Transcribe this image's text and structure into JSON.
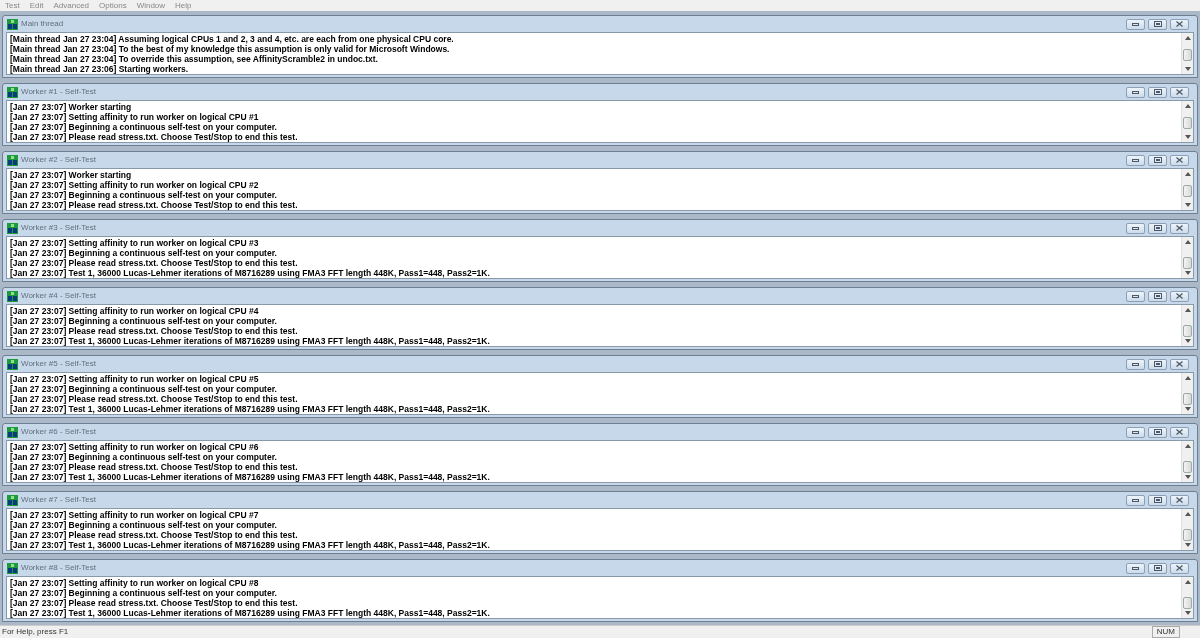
{
  "menu": [
    "Test",
    "Edit",
    "Advanced",
    "Options",
    "Window",
    "Help"
  ],
  "windows": [
    {
      "title": "Main thread",
      "lines": [
        "[Main thread Jan 27 23:04] Assuming logical CPUs 1 and 2, 3 and 4, etc. are each from one physical CPU core.",
        "[Main thread Jan 27 23:04] To the best of my knowledge this assumption is only valid for Microsoft Windows.",
        "[Main thread Jan 27 23:04] To override this assumption, see AffinityScramble2 in undoc.txt.",
        "[Main thread Jan 27 23:06] Starting workers."
      ]
    },
    {
      "title": "Worker #1 - Self-Test",
      "lines": [
        "[Jan 27 23:07] Worker starting",
        "[Jan 27 23:07] Setting affinity to run worker on logical CPU #1",
        "[Jan 27 23:07] Beginning a continuous self-test on your computer.",
        "[Jan 27 23:07] Please read stress.txt.  Choose Test/Stop to end this test."
      ]
    },
    {
      "title": "Worker #2 - Self-Test",
      "lines": [
        "[Jan 27 23:07] Worker starting",
        "[Jan 27 23:07] Setting affinity to run worker on logical CPU #2",
        "[Jan 27 23:07] Beginning a continuous self-test on your computer.",
        "[Jan 27 23:07] Please read stress.txt.  Choose Test/Stop to end this test."
      ]
    },
    {
      "title": "Worker #3 - Self-Test",
      "lines": [
        "[Jan 27 23:07] Setting affinity to run worker on logical CPU #3",
        "[Jan 27 23:07] Beginning a continuous self-test on your computer.",
        "[Jan 27 23:07] Please read stress.txt.  Choose Test/Stop to end this test.",
        "[Jan 27 23:07] Test 1, 36000 Lucas-Lehmer iterations of M8716289 using FMA3 FFT length 448K, Pass1=448, Pass2=1K."
      ]
    },
    {
      "title": "Worker #4 - Self-Test",
      "lines": [
        "[Jan 27 23:07] Setting affinity to run worker on logical CPU #4",
        "[Jan 27 23:07] Beginning a continuous self-test on your computer.",
        "[Jan 27 23:07] Please read stress.txt.  Choose Test/Stop to end this test.",
        "[Jan 27 23:07] Test 1, 36000 Lucas-Lehmer iterations of M8716289 using FMA3 FFT length 448K, Pass1=448, Pass2=1K."
      ]
    },
    {
      "title": "Worker #5 - Self-Test",
      "lines": [
        "[Jan 27 23:07] Setting affinity to run worker on logical CPU #5",
        "[Jan 27 23:07] Beginning a continuous self-test on your computer.",
        "[Jan 27 23:07] Please read stress.txt.  Choose Test/Stop to end this test.",
        "[Jan 27 23:07] Test 1, 36000 Lucas-Lehmer iterations of M8716289 using FMA3 FFT length 448K, Pass1=448, Pass2=1K."
      ]
    },
    {
      "title": "Worker #6 - Self-Test",
      "lines": [
        "[Jan 27 23:07] Setting affinity to run worker on logical CPU #6",
        "[Jan 27 23:07] Beginning a continuous self-test on your computer.",
        "[Jan 27 23:07] Please read stress.txt.  Choose Test/Stop to end this test.",
        "[Jan 27 23:07] Test 1, 36000 Lucas-Lehmer iterations of M8716289 using FMA3 FFT length 448K, Pass1=448, Pass2=1K."
      ]
    },
    {
      "title": "Worker #7 - Self-Test",
      "lines": [
        "[Jan 27 23:07] Setting affinity to run worker on logical CPU #7",
        "[Jan 27 23:07] Beginning a continuous self-test on your computer.",
        "[Jan 27 23:07] Please read stress.txt.  Choose Test/Stop to end this test.",
        "[Jan 27 23:07] Test 1, 36000 Lucas-Lehmer iterations of M8716289 using FMA3 FFT length 448K, Pass1=448, Pass2=1K."
      ]
    },
    {
      "title": "Worker #8 - Self-Test",
      "lines": [
        "[Jan 27 23:07] Setting affinity to run worker on logical CPU #8",
        "[Jan 27 23:07] Beginning a continuous self-test on your computer.",
        "[Jan 27 23:07] Please read stress.txt.  Choose Test/Stop to end this test.",
        "[Jan 27 23:07] Test 1, 36000 Lucas-Lehmer iterations of M8716289 using FMA3 FFT length 448K, Pass1=448, Pass2=1K."
      ]
    }
  ],
  "status_bar": {
    "text": "For Help, press F1",
    "indicators": [
      "NUM"
    ]
  }
}
